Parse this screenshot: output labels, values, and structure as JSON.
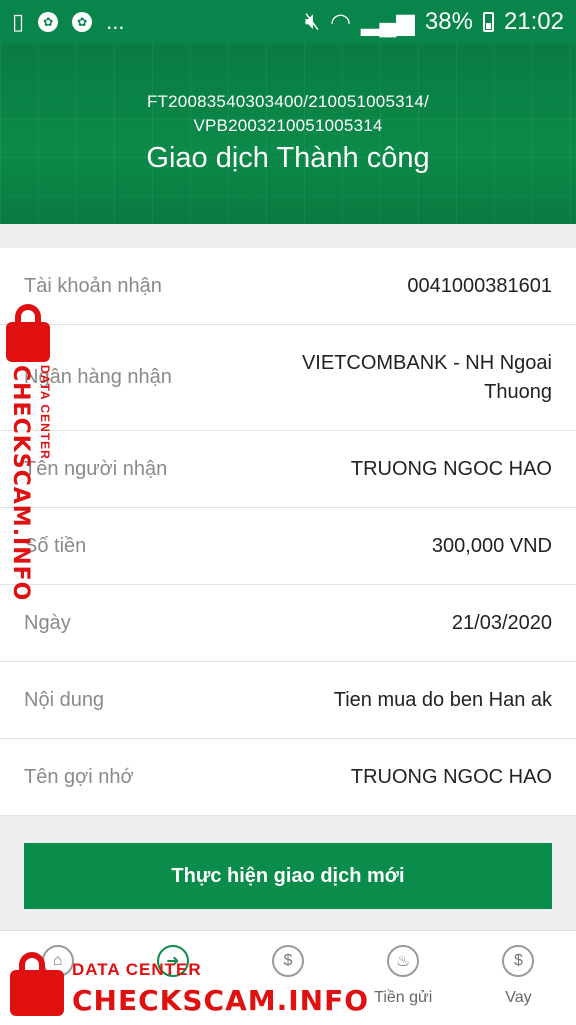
{
  "status_bar": {
    "battery": "38%",
    "time": "21:02",
    "more": "..."
  },
  "header": {
    "reference_line1": "FT20083540303400/210051005314/",
    "reference_line2": "VPB2003210051005314",
    "title": "Giao dịch Thành công"
  },
  "details": [
    {
      "label": "Tài khoản nhận",
      "value": "0041000381601"
    },
    {
      "label": "Ngân hàng nhận",
      "value": "VIETCOMBANK - NH Ngoai Thuong"
    },
    {
      "label": "Tên người nhận",
      "value": "TRUONG NGOC HAO"
    },
    {
      "label": "Số tiền",
      "value": "300,000 VND"
    },
    {
      "label": "Ngày",
      "value": "21/03/2020"
    },
    {
      "label": "Nội dung",
      "value": "Tien mua do ben Han ak"
    },
    {
      "label": "Tên gợi nhớ",
      "value": "TRUONG NGOC HAO"
    }
  ],
  "actions": {
    "new_transaction": "Thực hiện giao dịch mới"
  },
  "nav": {
    "items": [
      {
        "label": "",
        "icon": "home-icon"
      },
      {
        "label": "",
        "icon": "transfer-icon"
      },
      {
        "label": "",
        "icon": "payment-icon"
      },
      {
        "label": "Tiền gửi",
        "icon": "piggy-bank-icon"
      },
      {
        "label": "Vay",
        "icon": "money-bag-icon"
      }
    ]
  },
  "watermark": {
    "sub": "DATA CENTER",
    "main": "CHECKSCAM.INFO"
  },
  "colors": {
    "brand": "#07854a",
    "watermark": "#e01010"
  }
}
